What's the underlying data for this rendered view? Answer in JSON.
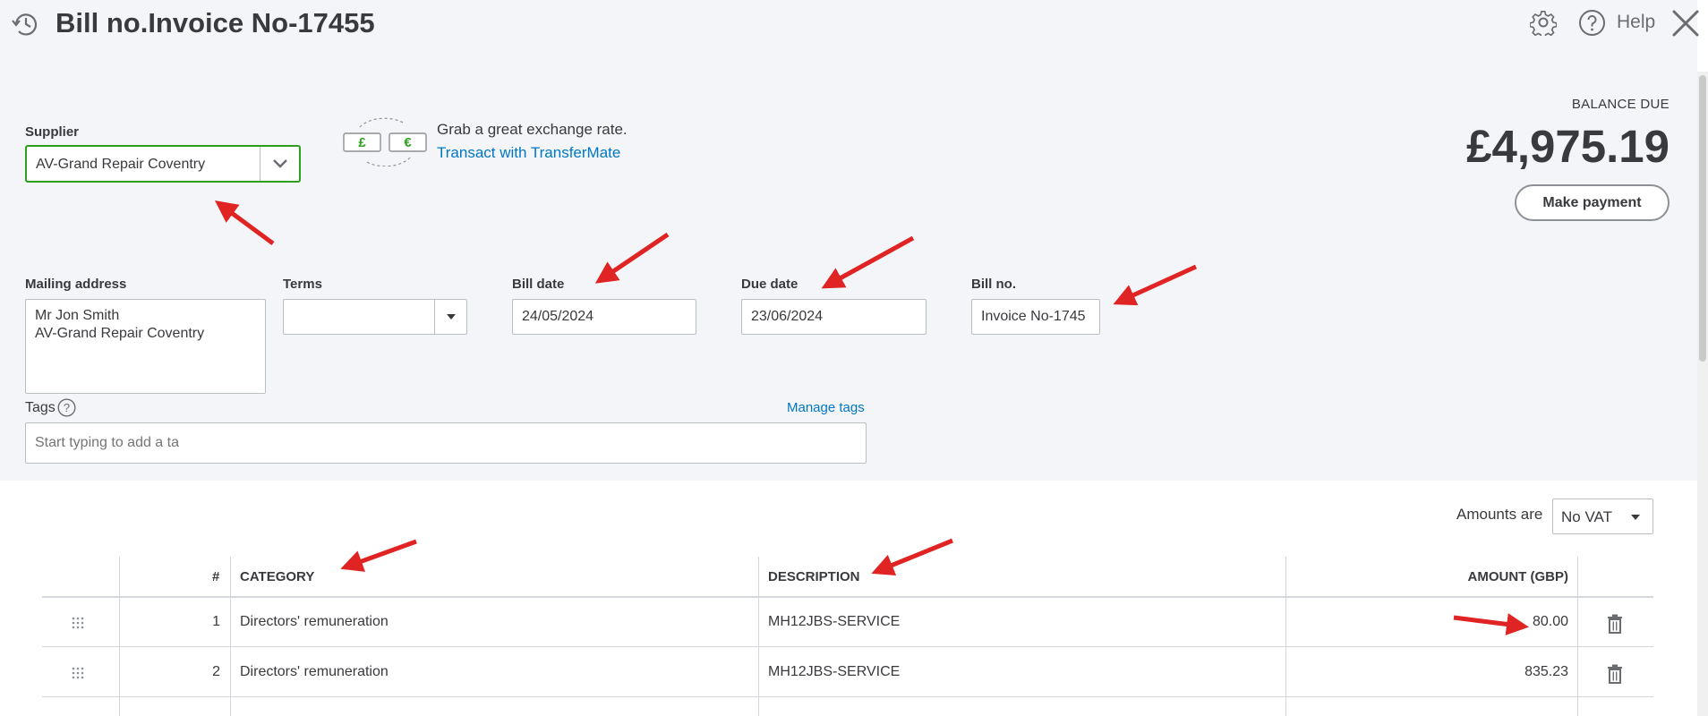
{
  "header": {
    "title": "Bill no.Invoice No-17455",
    "help_label": "Help"
  },
  "supplier": {
    "label": "Supplier",
    "value": "AV-Grand Repair Coventry"
  },
  "exchange": {
    "text": "Grab a great exchange rate.",
    "link": "Transact with TransferMate",
    "pound_symbol": "£",
    "euro_symbol": "€"
  },
  "balance": {
    "label": "BALANCE DUE",
    "amount": "£4,975.19",
    "make_payment_label": "Make payment"
  },
  "mailing": {
    "label": "Mailing address",
    "lines": [
      "Mr Jon Smith",
      "AV-Grand Repair Coventry"
    ]
  },
  "terms": {
    "label": "Terms",
    "value": ""
  },
  "bill_date": {
    "label": "Bill date",
    "value": "24/05/2024"
  },
  "due_date": {
    "label": "Due date",
    "value": "23/06/2024"
  },
  "bill_no": {
    "label": "Bill no.",
    "value": "Invoice No-1745"
  },
  "tags": {
    "label": "Tags",
    "help_symbol": "?",
    "manage_label": "Manage tags",
    "placeholder": "Start typing to add a ta"
  },
  "amounts": {
    "label": "Amounts are",
    "value": "No VAT"
  },
  "table": {
    "headers": {
      "num": "#",
      "category": "CATEGORY",
      "description": "DESCRIPTION",
      "amount": "AMOUNT (GBP)"
    },
    "rows": [
      {
        "num": "1",
        "category": "Directors' remuneration",
        "description": "MH12JBS-SERVICE",
        "amount": "80.00"
      },
      {
        "num": "2",
        "category": "Directors' remuneration",
        "description": "MH12JBS-SERVICE",
        "amount": "835.23"
      }
    ]
  },
  "colors": {
    "accent_green": "#2ca01c",
    "link_blue": "#0077c5",
    "annotation_red": "#e02424",
    "panel_bg": "#f4f5f8"
  }
}
